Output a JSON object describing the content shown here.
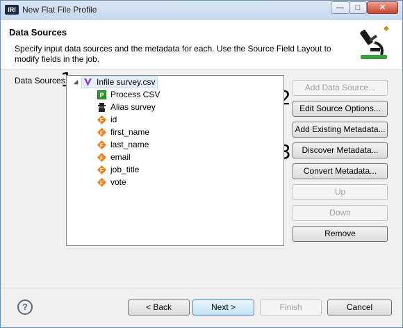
{
  "window": {
    "app_icon_text": "IRI",
    "title": "New Flat File Profile",
    "minimize": "—",
    "maximize": "□",
    "close": "✕"
  },
  "header": {
    "title": "Data Sources",
    "description": "Specify input data sources and the metadata for each. Use the Source Field Layout to modify fields in the job."
  },
  "data_sources_label": "Data Sources:",
  "annotations": [
    "1",
    "2",
    "3"
  ],
  "tree": {
    "root": {
      "label": "Infile survey.csv",
      "icon": "infile-icon",
      "expanded": true
    },
    "children": [
      {
        "label": "Process CSV",
        "icon": "process-icon"
      },
      {
        "label": "Alias survey",
        "icon": "alias-icon"
      },
      {
        "label": "id",
        "icon": "field-icon"
      },
      {
        "label": "first_name",
        "icon": "field-icon"
      },
      {
        "label": "last_name",
        "icon": "field-icon"
      },
      {
        "label": "email",
        "icon": "field-icon"
      },
      {
        "label": "job_title",
        "icon": "field-icon"
      },
      {
        "label": "vote",
        "icon": "field-icon"
      }
    ]
  },
  "side_buttons": [
    {
      "label": "Add Data Source...",
      "enabled": false
    },
    {
      "label": "Edit Source Options...",
      "enabled": true
    },
    {
      "label": "Add Existing Metadata...",
      "enabled": true
    },
    {
      "label": "Discover Metadata...",
      "enabled": true
    },
    {
      "label": "Convert Metadata...",
      "enabled": true
    },
    {
      "label": "Up",
      "enabled": false
    },
    {
      "label": "Down",
      "enabled": false
    },
    {
      "label": "Remove",
      "enabled": true
    }
  ],
  "footer": {
    "help": "?",
    "back": "< Back",
    "next": "Next >",
    "finish": "Finish",
    "cancel": "Cancel"
  },
  "colors": {
    "field_icon": "#f07d1c",
    "infile_icon": "#8a3fd1",
    "process_icon": "#2e9a2e",
    "selection": "#e4eefa"
  }
}
